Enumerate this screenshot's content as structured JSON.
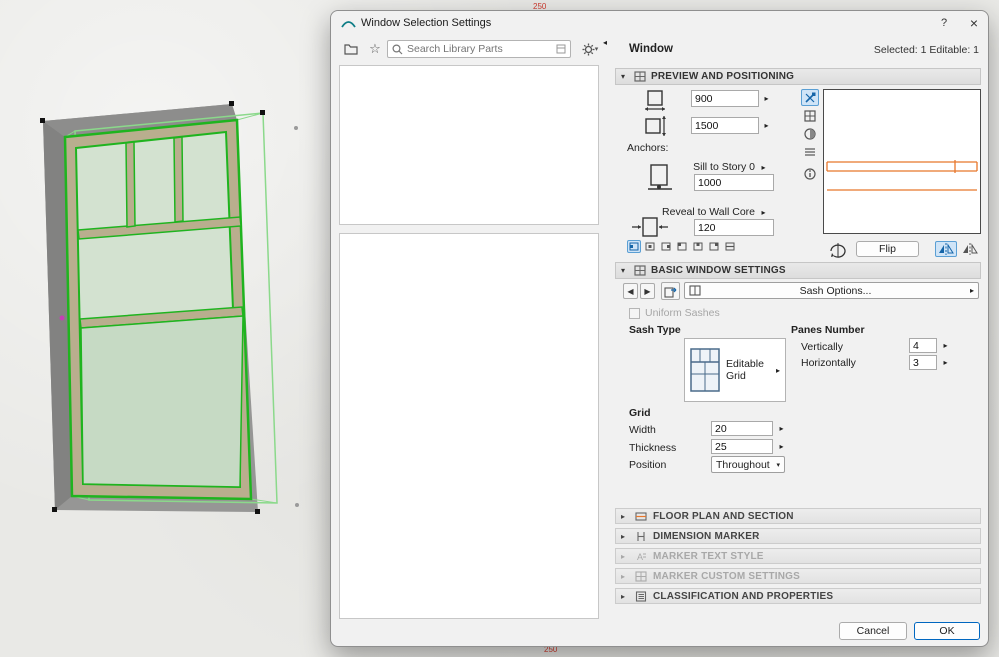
{
  "background": {
    "dim_top": "250",
    "dim_bottom": "250"
  },
  "dialog": {
    "title": "Window Selection Settings",
    "titlebar": {
      "help": "?",
      "close": "×"
    },
    "toolbar": {
      "search_placeholder": "Search Library Parts"
    },
    "header": {
      "subject": "Window",
      "selection": "Selected: 1 Editable: 1"
    },
    "preview_positioning": {
      "title": "PREVIEW AND POSITIONING",
      "width_value": "900",
      "height_value": "1500",
      "anchors_label": "Anchors:",
      "sill_anchor_label": "Sill to Story 0",
      "sill_value": "1000",
      "reveal_anchor_label": "Reveal to Wall Core",
      "reveal_value": "120",
      "flip_label": "Flip"
    },
    "basic": {
      "title": "BASIC WINDOW SETTINGS",
      "sash_options": "Sash Options...",
      "uniform_sashes": "Uniform Sashes",
      "sash_type_label": "Sash Type",
      "sash_type_value": "Editable Grid",
      "panes_label": "Panes Number",
      "vertically_label": "Vertically",
      "vertically_value": "4",
      "horizontally_label": "Horizontally",
      "horizontally_value": "3",
      "grid_label": "Grid",
      "width_label": "Width",
      "width_value": "20",
      "thickness_label": "Thickness",
      "thickness_value": "25",
      "position_label": "Position",
      "position_value": "Throughout"
    },
    "sections": [
      {
        "label": "FLOOR PLAN AND SECTION"
      },
      {
        "label": "DIMENSION MARKER"
      },
      {
        "label": "MARKER TEXT STYLE"
      },
      {
        "label": "MARKER CUSTOM SETTINGS"
      },
      {
        "label": "CLASSIFICATION AND PROPERTIES"
      }
    ],
    "footer": {
      "cancel": "Cancel",
      "ok": "OK"
    }
  }
}
